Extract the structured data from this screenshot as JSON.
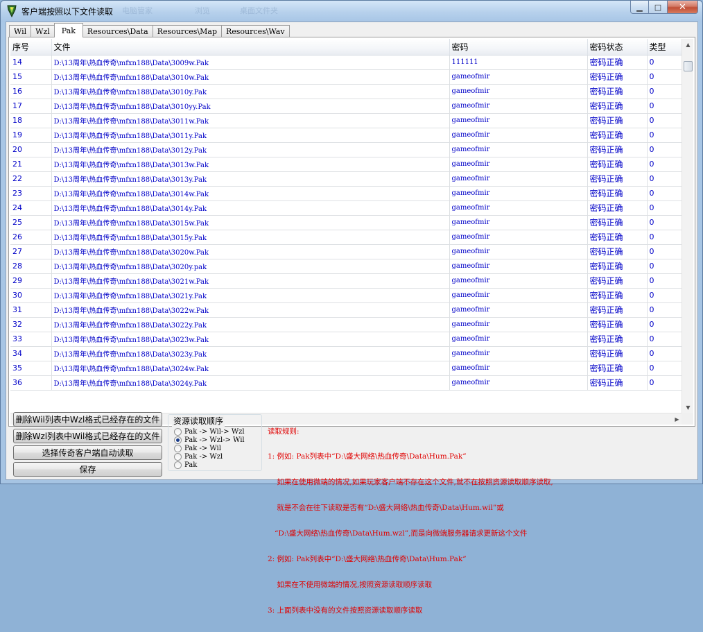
{
  "window": {
    "title": "客户端按照以下文件读取",
    "caption": {
      "minimize": "▁",
      "maximize": "□",
      "close": "✕"
    },
    "ghost_items": [
      "电脑管家",
      "浏览",
      "桌面文件夹"
    ]
  },
  "tabs": [
    {
      "label": "Wil",
      "active": false
    },
    {
      "label": "Wzl",
      "active": false
    },
    {
      "label": "Pak",
      "active": true
    },
    {
      "label": "Resources\\Data",
      "active": false
    },
    {
      "label": "Resources\\Map",
      "active": false
    },
    {
      "label": "Resources\\Wav",
      "active": false
    }
  ],
  "table": {
    "columns": [
      "序号",
      "文件",
      "密码",
      "密码状态",
      "类型"
    ],
    "rows": [
      [
        "14",
        "D:\\13周年\\热血传奇\\mfxn188\\Data\\3009w.Pak",
        "111111",
        "密码正确",
        "0"
      ],
      [
        "15",
        "D:\\13周年\\热血传奇\\mfxn188\\Data\\3010w.Pak",
        "gameofmir",
        "密码正确",
        "0"
      ],
      [
        "16",
        "D:\\13周年\\热血传奇\\mfxn188\\Data\\3010y.Pak",
        "gameofmir",
        "密码正确",
        "0"
      ],
      [
        "17",
        "D:\\13周年\\热血传奇\\mfxn188\\Data\\3010yy.Pak",
        "gameofmir",
        "密码正确",
        "0"
      ],
      [
        "18",
        "D:\\13周年\\热血传奇\\mfxn188\\Data\\3011w.Pak",
        "gameofmir",
        "密码正确",
        "0"
      ],
      [
        "19",
        "D:\\13周年\\热血传奇\\mfxn188\\Data\\3011y.Pak",
        "gameofmir",
        "密码正确",
        "0"
      ],
      [
        "20",
        "D:\\13周年\\热血传奇\\mfxn188\\Data\\3012y.Pak",
        "gameofmir",
        "密码正确",
        "0"
      ],
      [
        "21",
        "D:\\13周年\\热血传奇\\mfxn188\\Data\\3013w.Pak",
        "gameofmir",
        "密码正确",
        "0"
      ],
      [
        "22",
        "D:\\13周年\\热血传奇\\mfxn188\\Data\\3013y.Pak",
        "gameofmir",
        "密码正确",
        "0"
      ],
      [
        "23",
        "D:\\13周年\\热血传奇\\mfxn188\\Data\\3014w.Pak",
        "gameofmir",
        "密码正确",
        "0"
      ],
      [
        "24",
        "D:\\13周年\\热血传奇\\mfxn188\\Data\\3014y.Pak",
        "gameofmir",
        "密码正确",
        "0"
      ],
      [
        "25",
        "D:\\13周年\\热血传奇\\mfxn188\\Data\\3015w.Pak",
        "gameofmir",
        "密码正确",
        "0"
      ],
      [
        "26",
        "D:\\13周年\\热血传奇\\mfxn188\\Data\\3015y.Pak",
        "gameofmir",
        "密码正确",
        "0"
      ],
      [
        "27",
        "D:\\13周年\\热血传奇\\mfxn188\\Data\\3020w.Pak",
        "gameofmir",
        "密码正确",
        "0"
      ],
      [
        "28",
        "D:\\13周年\\热血传奇\\mfxn188\\Data\\3020y.pak",
        "gameofmir",
        "密码正确",
        "0"
      ],
      [
        "29",
        "D:\\13周年\\热血传奇\\mfxn188\\Data\\3021w.Pak",
        "gameofmir",
        "密码正确",
        "0"
      ],
      [
        "30",
        "D:\\13周年\\热血传奇\\mfxn188\\Data\\3021y.Pak",
        "gameofmir",
        "密码正确",
        "0"
      ],
      [
        "31",
        "D:\\13周年\\热血传奇\\mfxn188\\Data\\3022w.Pak",
        "gameofmir",
        "密码正确",
        "0"
      ],
      [
        "32",
        "D:\\13周年\\热血传奇\\mfxn188\\Data\\3022y.Pak",
        "gameofmir",
        "密码正确",
        "0"
      ],
      [
        "33",
        "D:\\13周年\\热血传奇\\mfxn188\\Data\\3023w.Pak",
        "gameofmir",
        "密码正确",
        "0"
      ],
      [
        "34",
        "D:\\13周年\\热血传奇\\mfxn188\\Data\\3023y.Pak",
        "gameofmir",
        "密码正确",
        "0"
      ],
      [
        "35",
        "D:\\13周年\\热血传奇\\mfxn188\\Data\\3024w.Pak",
        "gameofmir",
        "密码正确",
        "0"
      ],
      [
        "36",
        "D:\\13周年\\热血传奇\\mfxn188\\Data\\3024y.Pak",
        "gameofmir",
        "密码正确",
        "0"
      ]
    ]
  },
  "buttons": {
    "delete_wil": "删除Wil列表中Wzl格式已经存在的文件",
    "delete_wzl": "删除Wzl列表中Wil格式已经存在的文件",
    "auto_read": "选择传奇客户端自动读取",
    "save": "保存"
  },
  "read_order": {
    "title": "资源读取顺序",
    "options": [
      {
        "label": "Pak -> Wil-> Wzl",
        "checked": false
      },
      {
        "label": "Pak -> Wzl-> Wil",
        "checked": true
      },
      {
        "label": "Pak -> Wil",
        "checked": false
      },
      {
        "label": "Pak -> Wzl",
        "checked": false
      },
      {
        "label": "Pak",
        "checked": false
      }
    ]
  },
  "rules": {
    "heading": "读取规则:",
    "lines": [
      "1: 例如: Pak列表中“D:\\盛大网络\\热血传奇\\Data\\Hum.Pak”",
      "    如果在使用微端的情况,如果玩家客户端不存在这个文件,就不在按照资源读取顺序读取,",
      "    就是不会在往下读取是否有“D:\\盛大网络\\热血传奇\\Data\\Hum.wil”或",
      "   “D:\\盛大网络\\热血传奇\\Data\\Hum.wzl”,而是向微端服务器请求更新这个文件",
      "2: 例如: Pak列表中“D:\\盛大网络\\热血传奇\\Data\\Hum.Pak”",
      "    如果在不使用微端的情况,按照资源读取顺序读取",
      "3: 上面列表中没有的文件按照资源读取顺序读取"
    ]
  },
  "icons": {
    "app": "game-app-icon",
    "scroll_up": "▲",
    "scroll_down": "▼",
    "scroll_left": "◀",
    "scroll_right": "▶"
  },
  "colors": {
    "cell_text": "#0000c8",
    "rules_text": "#e00000",
    "title_bar": "#b7d1ec"
  }
}
